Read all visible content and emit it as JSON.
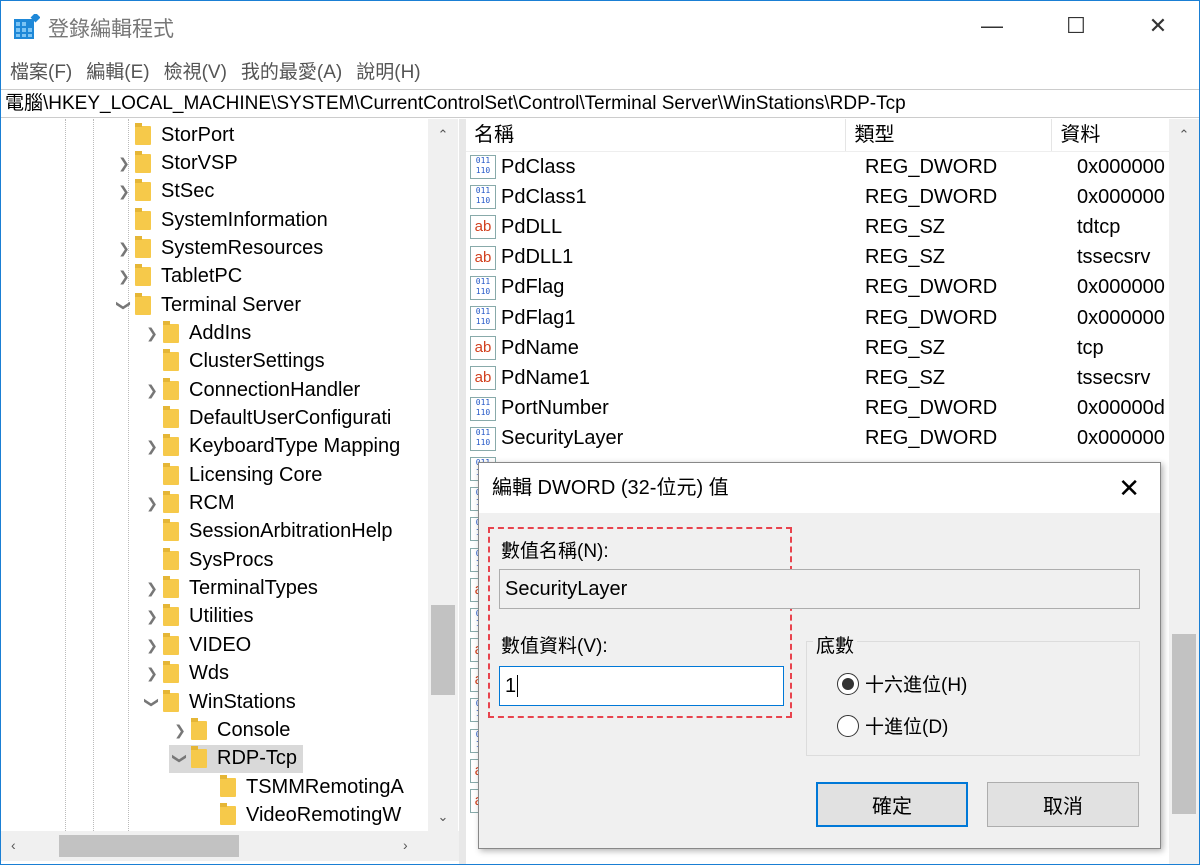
{
  "window": {
    "title": "登錄編輯程式",
    "minimize": "—",
    "maximize": "☐",
    "close": "✕"
  },
  "menu": [
    "檔案(F)",
    "編輯(E)",
    "檢視(V)",
    "我的最愛(A)",
    "說明(H)"
  ],
  "address": "電腦\\HKEY_LOCAL_MACHINE\\SYSTEM\\CurrentControlSet\\Control\\Terminal Server\\WinStations\\RDP-Tcp",
  "tree": [
    {
      "label": "StorPort",
      "level": 1,
      "arrow": ""
    },
    {
      "label": "StorVSP",
      "level": 1,
      "arrow": ">"
    },
    {
      "label": "StSec",
      "level": 1,
      "arrow": ">"
    },
    {
      "label": "SystemInformation",
      "level": 1,
      "arrow": ""
    },
    {
      "label": "SystemResources",
      "level": 1,
      "arrow": ">"
    },
    {
      "label": "TabletPC",
      "level": 1,
      "arrow": ">"
    },
    {
      "label": "Terminal Server",
      "level": 1,
      "arrow": "v"
    },
    {
      "label": "AddIns",
      "level": 2,
      "arrow": ">"
    },
    {
      "label": "ClusterSettings",
      "level": 2,
      "arrow": ""
    },
    {
      "label": "ConnectionHandler",
      "level": 2,
      "arrow": ">"
    },
    {
      "label": "DefaultUserConfigurati",
      "level": 2,
      "arrow": ""
    },
    {
      "label": "KeyboardType Mapping",
      "level": 2,
      "arrow": ">"
    },
    {
      "label": "Licensing Core",
      "level": 2,
      "arrow": ""
    },
    {
      "label": "RCM",
      "level": 2,
      "arrow": ">"
    },
    {
      "label": "SessionArbitrationHelp",
      "level": 2,
      "arrow": ""
    },
    {
      "label": "SysProcs",
      "level": 2,
      "arrow": ""
    },
    {
      "label": "TerminalTypes",
      "level": 2,
      "arrow": ">"
    },
    {
      "label": "Utilities",
      "level": 2,
      "arrow": ">"
    },
    {
      "label": "VIDEO",
      "level": 2,
      "arrow": ">"
    },
    {
      "label": "Wds",
      "level": 2,
      "arrow": ">"
    },
    {
      "label": "WinStations",
      "level": 2,
      "arrow": "v"
    },
    {
      "label": "Console",
      "level": 3,
      "arrow": ">"
    },
    {
      "label": "RDP-Tcp",
      "level": 3,
      "arrow": "v",
      "selected": true
    },
    {
      "label": "TSMMRemotingA",
      "level": 4,
      "arrow": ""
    },
    {
      "label": "VideoRemotingW",
      "level": 4,
      "arrow": ""
    }
  ],
  "list": {
    "headers": [
      "名稱",
      "類型",
      "資料"
    ],
    "rows": [
      {
        "name": "PdClass",
        "type": "REG_DWORD",
        "data": "0x000000",
        "icon": "dword"
      },
      {
        "name": "PdClass1",
        "type": "REG_DWORD",
        "data": "0x000000",
        "icon": "dword"
      },
      {
        "name": "PdDLL",
        "type": "REG_SZ",
        "data": "tdtcp",
        "icon": "sz"
      },
      {
        "name": "PdDLL1",
        "type": "REG_SZ",
        "data": "tssecsrv",
        "icon": "sz"
      },
      {
        "name": "PdFlag",
        "type": "REG_DWORD",
        "data": "0x000000",
        "icon": "dword"
      },
      {
        "name": "PdFlag1",
        "type": "REG_DWORD",
        "data": "0x000000",
        "icon": "dword"
      },
      {
        "name": "PdName",
        "type": "REG_SZ",
        "data": "tcp",
        "icon": "sz"
      },
      {
        "name": "PdName1",
        "type": "REG_SZ",
        "data": "tssecsrv",
        "icon": "sz"
      },
      {
        "name": "PortNumber",
        "type": "REG_DWORD",
        "data": "0x00000d",
        "icon": "dword"
      },
      {
        "name": "SecurityLayer",
        "type": "REG_DWORD",
        "data": "0x000000",
        "icon": "dword"
      }
    ],
    "hidden_icons": [
      "dword",
      "dword",
      "dword",
      "dword",
      "sz",
      "dword",
      "sz",
      "sz",
      "dword",
      "dword",
      "sz",
      "sz"
    ]
  },
  "dialog": {
    "title": "編輯 DWORD (32-位元) 值",
    "close": "✕",
    "name_label": "數值名稱(N):",
    "name_value": "SecurityLayer",
    "data_label": "數值資料(V):",
    "data_value": "1",
    "base_label": "底數",
    "hex_label": "十六進位(H)",
    "dec_label": "十進位(D)",
    "base_selected": "hex",
    "ok": "確定",
    "cancel": "取消"
  },
  "icon_text": {
    "dword": "011\n110",
    "sz": "ab"
  }
}
